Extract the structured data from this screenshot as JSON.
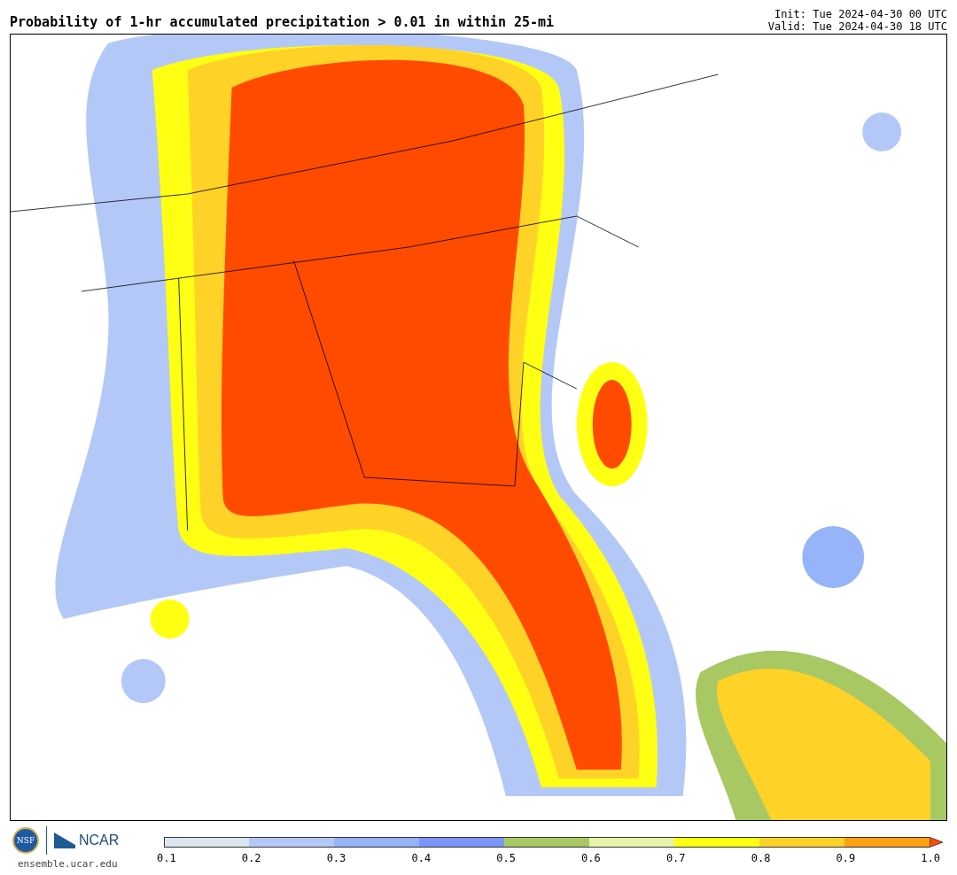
{
  "header": {
    "title": "Probability of 1-hr accumulated precipitation > 0.01 in within 25-mi",
    "init": "Init: Tue 2024-04-30 00 UTC",
    "valid": "Valid: Tue 2024-04-30 18 UTC"
  },
  "footer": {
    "logos": [
      "NSF",
      "NCAR"
    ],
    "site": "ensemble.ucar.edu"
  },
  "colorbar": {
    "segments": [
      {
        "color": "#dce6f0"
      },
      {
        "color": "#b4c8f8"
      },
      {
        "color": "#96b4fa"
      },
      {
        "color": "#7d96fa"
      },
      {
        "color": "#a8c864"
      },
      {
        "color": "#e6f4aa"
      },
      {
        "color": "#ffff14"
      },
      {
        "color": "#ffd228"
      },
      {
        "color": "#ffa014"
      }
    ],
    "arrow": {
      "color": "#ff4b00"
    },
    "ticks": [
      "0.1",
      "0.2",
      "0.3",
      "0.4",
      "0.5",
      "0.6",
      "0.7",
      "0.8",
      "0.9",
      "1.0"
    ]
  }
}
